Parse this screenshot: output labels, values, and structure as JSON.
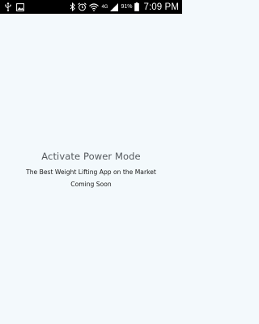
{
  "status_bar": {
    "icons_left": [
      "usb-icon",
      "image-icon"
    ],
    "icons_right": [
      "bluetooth-icon",
      "alarm-icon",
      "wifi-icon",
      "lte-icon",
      "signal-icon",
      "battery-icon"
    ],
    "network_label": "4G",
    "battery_percent": "91%",
    "time": "7:09 PM"
  },
  "main": {
    "title": "Activate Power Mode",
    "tagline": "The Best Weight Lifting App on the Market",
    "status": "Coming Soon"
  },
  "colors": {
    "background": "#f3f9fc",
    "status_bar": "#000000",
    "title_text": "#555a5e",
    "body_text": "#1a1a1a"
  }
}
